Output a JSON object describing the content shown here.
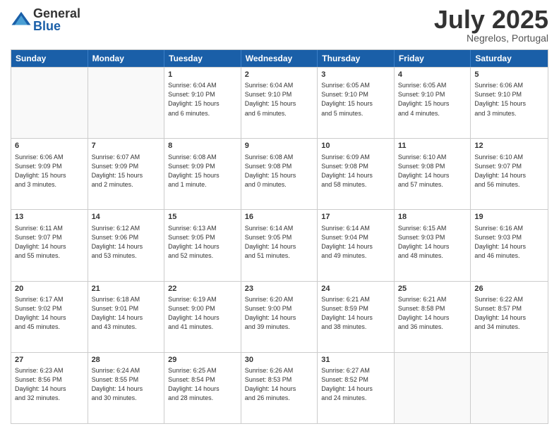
{
  "logo": {
    "general": "General",
    "blue": "Blue"
  },
  "title": "July 2025",
  "location": "Negrelos, Portugal",
  "days": [
    "Sunday",
    "Monday",
    "Tuesday",
    "Wednesday",
    "Thursday",
    "Friday",
    "Saturday"
  ],
  "rows": [
    [
      {
        "day": "",
        "info": ""
      },
      {
        "day": "",
        "info": ""
      },
      {
        "day": "1",
        "info": "Sunrise: 6:04 AM\nSunset: 9:10 PM\nDaylight: 15 hours\nand 6 minutes."
      },
      {
        "day": "2",
        "info": "Sunrise: 6:04 AM\nSunset: 9:10 PM\nDaylight: 15 hours\nand 6 minutes."
      },
      {
        "day": "3",
        "info": "Sunrise: 6:05 AM\nSunset: 9:10 PM\nDaylight: 15 hours\nand 5 minutes."
      },
      {
        "day": "4",
        "info": "Sunrise: 6:05 AM\nSunset: 9:10 PM\nDaylight: 15 hours\nand 4 minutes."
      },
      {
        "day": "5",
        "info": "Sunrise: 6:06 AM\nSunset: 9:10 PM\nDaylight: 15 hours\nand 3 minutes."
      }
    ],
    [
      {
        "day": "6",
        "info": "Sunrise: 6:06 AM\nSunset: 9:09 PM\nDaylight: 15 hours\nand 3 minutes."
      },
      {
        "day": "7",
        "info": "Sunrise: 6:07 AM\nSunset: 9:09 PM\nDaylight: 15 hours\nand 2 minutes."
      },
      {
        "day": "8",
        "info": "Sunrise: 6:08 AM\nSunset: 9:09 PM\nDaylight: 15 hours\nand 1 minute."
      },
      {
        "day": "9",
        "info": "Sunrise: 6:08 AM\nSunset: 9:08 PM\nDaylight: 15 hours\nand 0 minutes."
      },
      {
        "day": "10",
        "info": "Sunrise: 6:09 AM\nSunset: 9:08 PM\nDaylight: 14 hours\nand 58 minutes."
      },
      {
        "day": "11",
        "info": "Sunrise: 6:10 AM\nSunset: 9:08 PM\nDaylight: 14 hours\nand 57 minutes."
      },
      {
        "day": "12",
        "info": "Sunrise: 6:10 AM\nSunset: 9:07 PM\nDaylight: 14 hours\nand 56 minutes."
      }
    ],
    [
      {
        "day": "13",
        "info": "Sunrise: 6:11 AM\nSunset: 9:07 PM\nDaylight: 14 hours\nand 55 minutes."
      },
      {
        "day": "14",
        "info": "Sunrise: 6:12 AM\nSunset: 9:06 PM\nDaylight: 14 hours\nand 53 minutes."
      },
      {
        "day": "15",
        "info": "Sunrise: 6:13 AM\nSunset: 9:05 PM\nDaylight: 14 hours\nand 52 minutes."
      },
      {
        "day": "16",
        "info": "Sunrise: 6:14 AM\nSunset: 9:05 PM\nDaylight: 14 hours\nand 51 minutes."
      },
      {
        "day": "17",
        "info": "Sunrise: 6:14 AM\nSunset: 9:04 PM\nDaylight: 14 hours\nand 49 minutes."
      },
      {
        "day": "18",
        "info": "Sunrise: 6:15 AM\nSunset: 9:03 PM\nDaylight: 14 hours\nand 48 minutes."
      },
      {
        "day": "19",
        "info": "Sunrise: 6:16 AM\nSunset: 9:03 PM\nDaylight: 14 hours\nand 46 minutes."
      }
    ],
    [
      {
        "day": "20",
        "info": "Sunrise: 6:17 AM\nSunset: 9:02 PM\nDaylight: 14 hours\nand 45 minutes."
      },
      {
        "day": "21",
        "info": "Sunrise: 6:18 AM\nSunset: 9:01 PM\nDaylight: 14 hours\nand 43 minutes."
      },
      {
        "day": "22",
        "info": "Sunrise: 6:19 AM\nSunset: 9:00 PM\nDaylight: 14 hours\nand 41 minutes."
      },
      {
        "day": "23",
        "info": "Sunrise: 6:20 AM\nSunset: 9:00 PM\nDaylight: 14 hours\nand 39 minutes."
      },
      {
        "day": "24",
        "info": "Sunrise: 6:21 AM\nSunset: 8:59 PM\nDaylight: 14 hours\nand 38 minutes."
      },
      {
        "day": "25",
        "info": "Sunrise: 6:21 AM\nSunset: 8:58 PM\nDaylight: 14 hours\nand 36 minutes."
      },
      {
        "day": "26",
        "info": "Sunrise: 6:22 AM\nSunset: 8:57 PM\nDaylight: 14 hours\nand 34 minutes."
      }
    ],
    [
      {
        "day": "27",
        "info": "Sunrise: 6:23 AM\nSunset: 8:56 PM\nDaylight: 14 hours\nand 32 minutes."
      },
      {
        "day": "28",
        "info": "Sunrise: 6:24 AM\nSunset: 8:55 PM\nDaylight: 14 hours\nand 30 minutes."
      },
      {
        "day": "29",
        "info": "Sunrise: 6:25 AM\nSunset: 8:54 PM\nDaylight: 14 hours\nand 28 minutes."
      },
      {
        "day": "30",
        "info": "Sunrise: 6:26 AM\nSunset: 8:53 PM\nDaylight: 14 hours\nand 26 minutes."
      },
      {
        "day": "31",
        "info": "Sunrise: 6:27 AM\nSunset: 8:52 PM\nDaylight: 14 hours\nand 24 minutes."
      },
      {
        "day": "",
        "info": ""
      },
      {
        "day": "",
        "info": ""
      }
    ]
  ]
}
